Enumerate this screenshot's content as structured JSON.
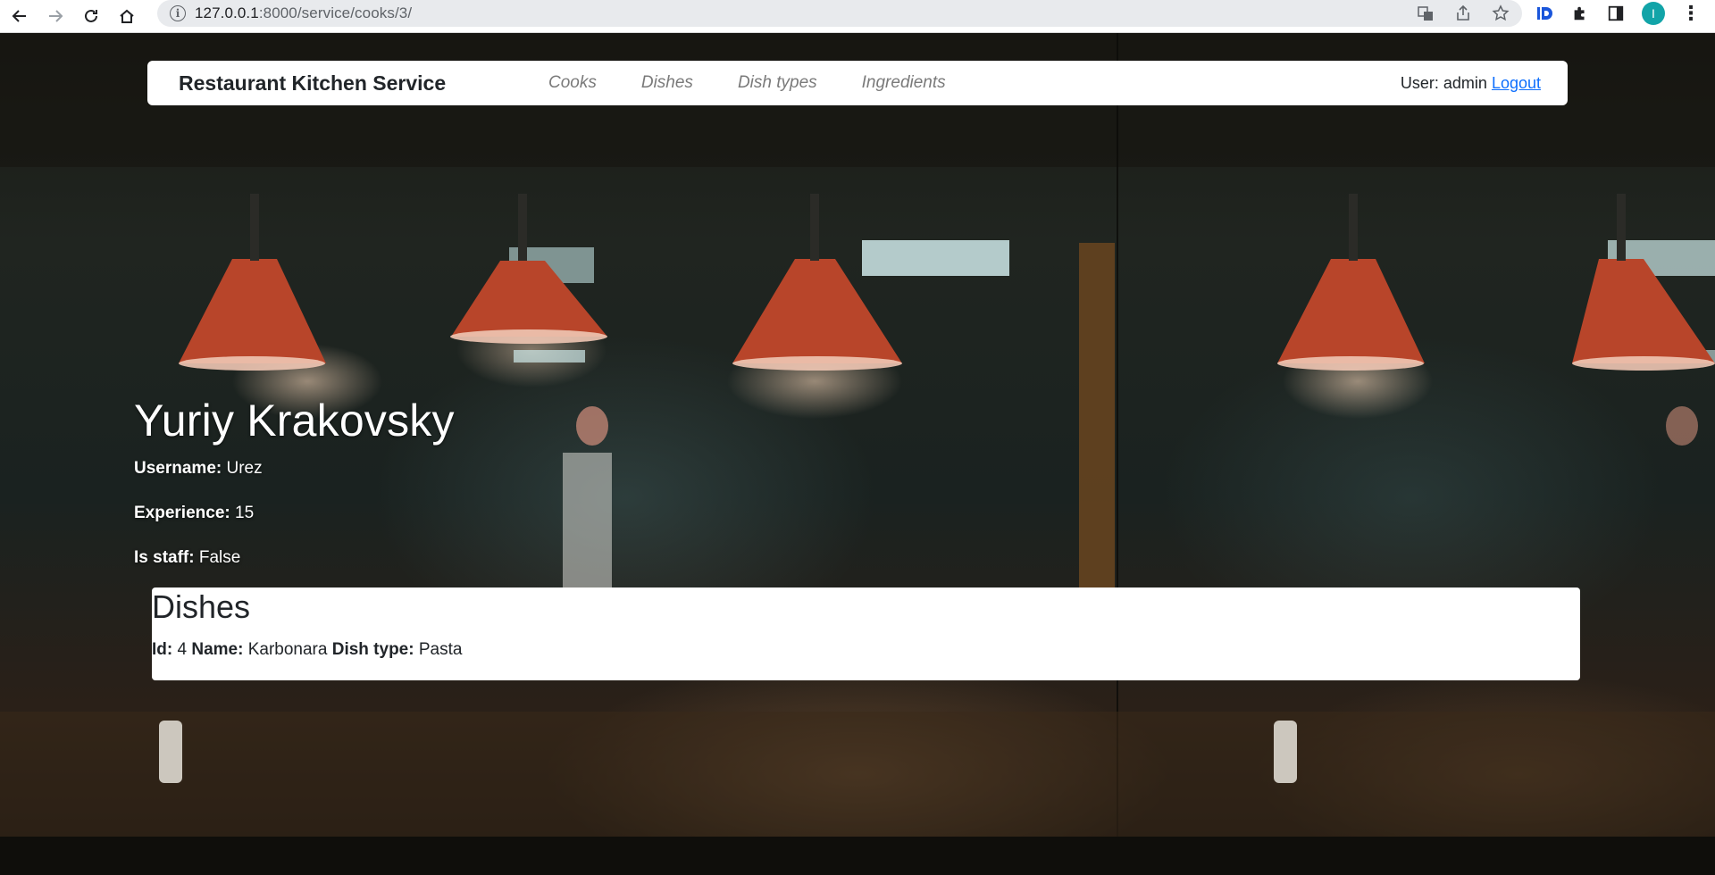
{
  "browser": {
    "url_host": "127.0.0.1",
    "url_path": ":8000/service/cooks/3/",
    "profile_initial": "I"
  },
  "nav": {
    "brand": "Restaurant Kitchen Service",
    "links": [
      "Cooks",
      "Dishes",
      "Dish types",
      "Ingredients"
    ],
    "user_label": "User: admin",
    "logout": "Logout"
  },
  "cook": {
    "full_name": "Yuriy Krakovsky",
    "username_label": "Username:",
    "username": "Urez",
    "experience_label": "Experience:",
    "experience": "15",
    "is_staff_label": "Is staff:",
    "is_staff": "False"
  },
  "dishes": {
    "heading": "Dishes",
    "items": [
      {
        "id_label": "Id:",
        "id": "4",
        "name_label": "Name:",
        "name": "Karbonara",
        "type_label": "Dish type:",
        "type": "Pasta"
      }
    ]
  },
  "colors": {
    "link": "#0d6efd",
    "menu_text": "#7a7a7a",
    "profile": "#12a4a8"
  }
}
